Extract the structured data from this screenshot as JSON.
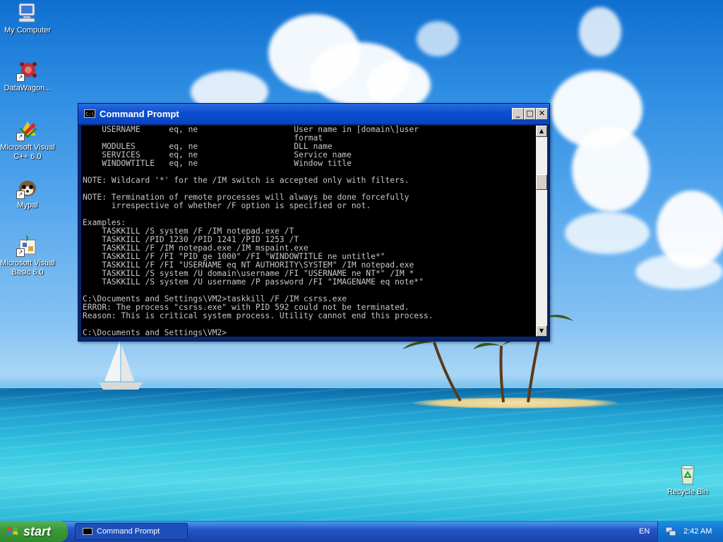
{
  "desktop": {
    "icons": [
      {
        "label": "My Computer",
        "icon": "my-computer-icon"
      },
      {
        "label": "DataWagon...",
        "icon": "datawagon-icon"
      },
      {
        "label": "Microsoft Visual C++ 6.0",
        "icon": "visual-cpp-icon"
      },
      {
        "label": "Mypal",
        "icon": "mypal-icon"
      },
      {
        "label": "Microsoft Visual Basic 6.0",
        "icon": "visual-basic-icon"
      },
      {
        "label": "Recycle Bin",
        "icon": "recycle-bin-icon"
      }
    ]
  },
  "window": {
    "title": "Command Prompt",
    "buttons": {
      "minimize": "_",
      "maximize": "□",
      "close": "✕"
    },
    "console_lines": [
      "    USERNAME      eq, ne                    User name in [domain\\]user",
      "                                            format",
      "    MODULES       eq, ne                    DLL name",
      "    SERVICES      eq, ne                    Service name",
      "    WINDOWTITLE   eq, ne                    Window title",
      "",
      "NOTE: Wildcard '*' for the /IM switch is accepted only with filters.",
      "",
      "NOTE: Termination of remote processes will always be done forcefully",
      "      irrespective of whether /F option is specified or not.",
      "",
      "Examples:",
      "    TASKKILL /S system /F /IM notepad.exe /T",
      "    TASKKILL /PID 1230 /PID 1241 /PID 1253 /T",
      "    TASKKILL /F /IM notepad.exe /IM mspaint.exe",
      "    TASKKILL /F /FI \"PID ge 1000\" /FI \"WINDOWTITLE ne untitle*\"",
      "    TASKKILL /F /FI \"USERNAME eq NT AUTHORITY\\SYSTEM\" /IM notepad.exe",
      "    TASKKILL /S system /U domain\\username /FI \"USERNAME ne NT*\" /IM *",
      "    TASKKILL /S system /U username /P password /FI \"IMAGENAME eq note*\"",
      "",
      "C:\\Documents and Settings\\VM2>taskkill /F /IM csrss.exe",
      "ERROR: The process \"csrss.exe\" with PID 592 could not be terminated.",
      "Reason: This is critical system process. Utility cannot end this process.",
      "",
      "C:\\Documents and Settings\\VM2>"
    ]
  },
  "taskbar": {
    "start_label": "start",
    "tasks": [
      {
        "label": "Command Prompt",
        "icon": "console-icon"
      }
    ],
    "language": "EN",
    "clock": "2:42 AM"
  },
  "colors": {
    "titlebar": "#0a4fd0",
    "taskbar": "#2457c9",
    "start_button": "#3c9a3a",
    "console_bg": "#000000",
    "console_text": "#c8c8c8"
  }
}
